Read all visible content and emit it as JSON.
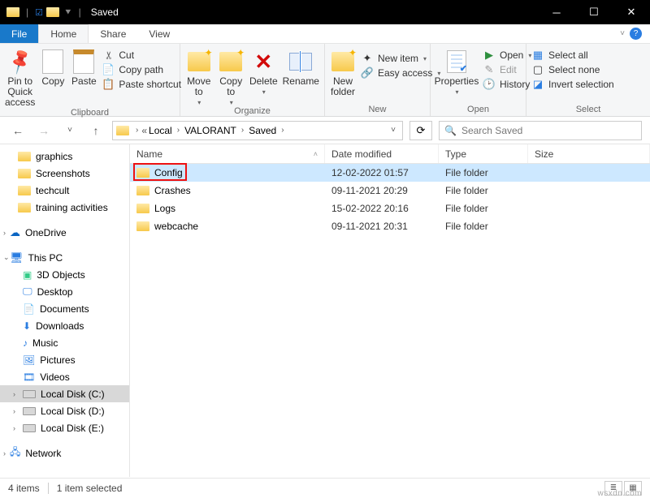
{
  "window": {
    "title": "Saved"
  },
  "tabs": {
    "file": "File",
    "home": "Home",
    "share": "Share",
    "view": "View"
  },
  "ribbon": {
    "clipboard": {
      "label": "Clipboard",
      "pin": "Pin to Quick\naccess",
      "copy": "Copy",
      "paste": "Paste",
      "cut": "Cut",
      "copypath": "Copy path",
      "pasteshortcut": "Paste shortcut"
    },
    "organize": {
      "label": "Organize",
      "moveto": "Move\nto",
      "copyto": "Copy\nto",
      "delete": "Delete",
      "rename": "Rename"
    },
    "new": {
      "label": "New",
      "newfolder": "New\nfolder",
      "newitem": "New item",
      "easyaccess": "Easy access"
    },
    "open": {
      "label": "Open",
      "properties": "Properties",
      "open": "Open",
      "edit": "Edit",
      "history": "History"
    },
    "select": {
      "label": "Select",
      "selectall": "Select all",
      "selectnone": "Select none",
      "invert": "Invert selection"
    }
  },
  "breadcrumb": {
    "parts": [
      "Local",
      "VALORANT",
      "Saved"
    ]
  },
  "search": {
    "placeholder": "Search Saved"
  },
  "columns": {
    "name": "Name",
    "date": "Date modified",
    "type": "Type",
    "size": "Size"
  },
  "files": [
    {
      "name": "Config",
      "date": "12-02-2022 01:57",
      "type": "File folder",
      "selected": true
    },
    {
      "name": "Crashes",
      "date": "09-11-2021 20:29",
      "type": "File folder",
      "selected": false
    },
    {
      "name": "Logs",
      "date": "15-02-2022 20:16",
      "type": "File folder",
      "selected": false
    },
    {
      "name": "webcache",
      "date": "09-11-2021 20:31",
      "type": "File folder",
      "selected": false
    }
  ],
  "nav": {
    "quick": [
      "graphics",
      "Screenshots",
      "techcult",
      "training activities"
    ],
    "onedrive": "OneDrive",
    "thispc": "This PC",
    "pcitems": [
      "3D Objects",
      "Desktop",
      "Documents",
      "Downloads",
      "Music",
      "Pictures",
      "Videos",
      "Local Disk (C:)",
      "Local Disk (D:)",
      "Local Disk (E:)"
    ],
    "network": "Network"
  },
  "status": {
    "items": "4 items",
    "selected": "1 item selected"
  },
  "watermark": "wsxdn.com"
}
